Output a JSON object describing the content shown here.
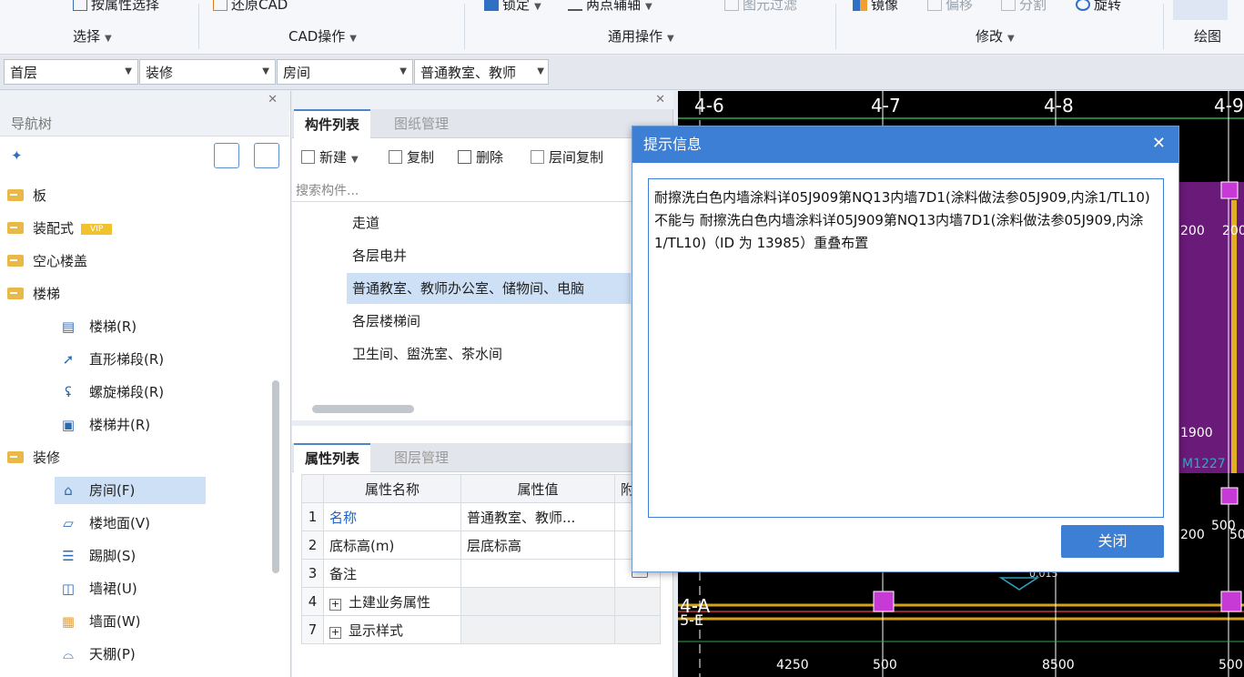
{
  "ribbon": {
    "buttons": {
      "select_by_attr": "按属性选择",
      "restore_cad": "还原CAD",
      "lock": "锁定",
      "two_point_axis": "两点辅轴",
      "filter_elements": "图元过滤",
      "mirror": "镜像",
      "offset": "偏移",
      "split": "分割",
      "rotate": "旋转"
    },
    "groups": {
      "select": "选择",
      "cad_ops": "CAD操作",
      "general_ops": "通用操作",
      "modify": "修改",
      "draw": "绘图"
    }
  },
  "filterbar": {
    "floor": "首层",
    "category": "装修",
    "type": "房间",
    "component": "普通教室、教师"
  },
  "nav": {
    "title": "导航树",
    "items": {
      "slab": "板",
      "prefab": "装配式",
      "vip": "VIP",
      "hollow_slab": "空心楼盖",
      "stairs_folder": "楼梯",
      "stairs": "楼梯(R)",
      "straight_flight": "直形梯段(R)",
      "spiral_flight": "螺旋梯段(R)",
      "stairwell": "楼梯井(R)",
      "finish_folder": "装修",
      "room": "房间(F)",
      "floor_surface": "楼地面(V)",
      "skirting": "踢脚(S)",
      "dado": "墙裙(U)",
      "wall_surface": "墙面(W)",
      "ceiling": "天棚(P)"
    }
  },
  "complist": {
    "tabs": [
      "构件列表",
      "图纸管理"
    ],
    "toolbar": {
      "new": "新建",
      "copy": "复制",
      "delete": "删除",
      "floor_copy": "层间复制"
    },
    "search_placeholder": "搜索构件...",
    "items": [
      "走道",
      "各层电井",
      "普通教室、教师办公室、储物间、电脑",
      "各层楼梯间",
      "卫生间、盥洗室、茶水间"
    ]
  },
  "proplist": {
    "tabs": [
      "属性列表",
      "图层管理"
    ],
    "headers": {
      "name": "属性名称",
      "value": "属性值",
      "extra": "附"
    },
    "rows": [
      {
        "num": "1",
        "name": "名称",
        "value": "普通教室、教师..."
      },
      {
        "num": "2",
        "name": "底标高(m)",
        "value": "层底标高"
      },
      {
        "num": "3",
        "name": "备注",
        "value": ""
      },
      {
        "num": "4",
        "name": "土建业务属性",
        "value": ""
      },
      {
        "num": "7",
        "name": "显示样式",
        "value": ""
      }
    ]
  },
  "cad": {
    "axes": [
      "4-6",
      "4-7",
      "4-8",
      "4-9",
      "4-A",
      "5-E"
    ],
    "labels": {
      "d200a": "200",
      "d200b": "200",
      "d1900": "1900",
      "m1227": "M1227",
      "d200c": "200",
      "d500a": "500",
      "d500b": "500",
      "elev": "0.015",
      "b4250": "4250",
      "b500a": "500",
      "b8500": "8500",
      "b500b": "500"
    }
  },
  "dialog": {
    "title": "提示信息",
    "message": "耐擦洗白色内墙涂料详05J909第NQ13内墙7D1(涂料做法参05J909,内涂1/TL10) 不能与 耐擦洗白色内墙涂料详05J909第NQ13内墙7D1(涂料做法参05J909,内涂1/TL10)（ID 为 13985）重叠布置",
    "close_button": "关闭"
  }
}
